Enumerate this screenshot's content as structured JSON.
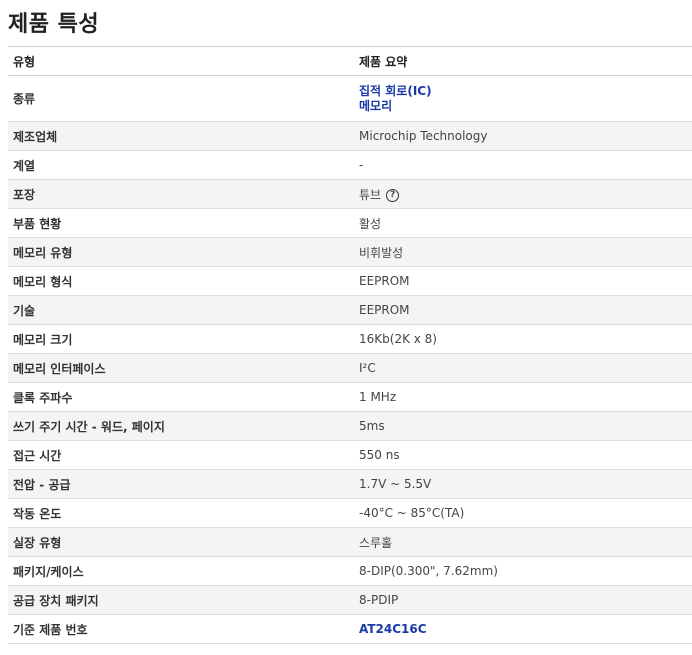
{
  "page_title": "제품 특성",
  "table": {
    "headers": [
      "유형",
      "제품 요약"
    ],
    "rows": [
      {
        "attr": "종류",
        "links": [
          "집적 회로(IC)",
          "메모리"
        ]
      },
      {
        "attr": "제조업체",
        "value": "Microchip Technology"
      },
      {
        "attr": "계열",
        "value": "-"
      },
      {
        "attr": "포장",
        "value": "튜브",
        "help_icon": "question-circle-icon"
      },
      {
        "attr": "부품 현황",
        "value": "활성"
      },
      {
        "attr": "메모리 유형",
        "value": "비휘발성"
      },
      {
        "attr": "메모리 형식",
        "value": "EEPROM"
      },
      {
        "attr": "기술",
        "value": "EEPROM"
      },
      {
        "attr": "메모리 크기",
        "value": "16Kb(2K x 8)"
      },
      {
        "attr": "메모리 인터페이스",
        "value": "I²C"
      },
      {
        "attr": "클록 주파수",
        "value": "1 MHz"
      },
      {
        "attr": "쓰기 주기 시간 - 워드, 페이지",
        "value": "5ms"
      },
      {
        "attr": "접근 시간",
        "value": "550 ns"
      },
      {
        "attr": "전압 - 공급",
        "value": "1.7V ~ 5.5V"
      },
      {
        "attr": "작동 온도",
        "value": "-40°C ~ 85°C(TA)"
      },
      {
        "attr": "실장 유형",
        "value": "스루홀"
      },
      {
        "attr": "패키지/케이스",
        "value": "8-DIP(0.300\", 7.62mm)"
      },
      {
        "attr": "공급 장치 패키지",
        "value": "8-PDIP"
      },
      {
        "attr": "기준 제품 번호",
        "link": "AT24C16C"
      }
    ]
  },
  "colors": {
    "link": "#1a39a8",
    "stripe": "#f4f4f4"
  }
}
